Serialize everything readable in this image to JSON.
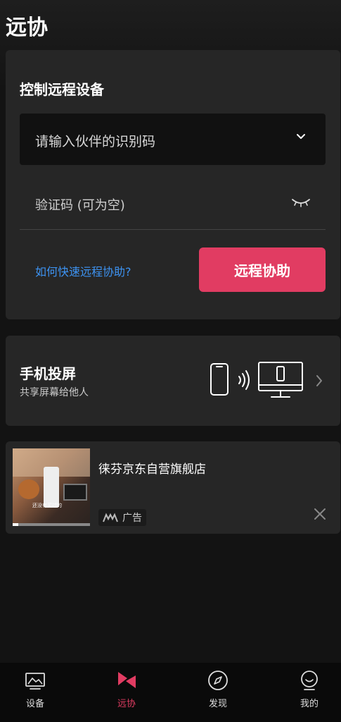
{
  "header": {
    "title": "远协"
  },
  "remote": {
    "heading": "控制远程设备",
    "partner_placeholder": "请输入伙伴的识别码",
    "code_placeholder": "验证码 (可为空)",
    "help_link": "如何快速远程协助?",
    "button_label": "远程协助"
  },
  "cast": {
    "title": "手机投屏",
    "subtitle": "共享屏幕给他人"
  },
  "ad": {
    "title": "徕芬京东自营旗舰店",
    "thumb_caption": "还没有买过的",
    "badge": "广告"
  },
  "tabs": [
    {
      "label": "设备",
      "icon": "monitor-image-icon",
      "active": false
    },
    {
      "label": "远协",
      "icon": "bow-tie-icon",
      "active": true
    },
    {
      "label": "发现",
      "icon": "compass-icon",
      "active": false
    },
    {
      "label": "我的",
      "icon": "user-icon",
      "active": false
    }
  ],
  "colors": {
    "accent": "#e13c62",
    "link": "#3d93f2",
    "card": "#262626",
    "background": "#131313"
  }
}
